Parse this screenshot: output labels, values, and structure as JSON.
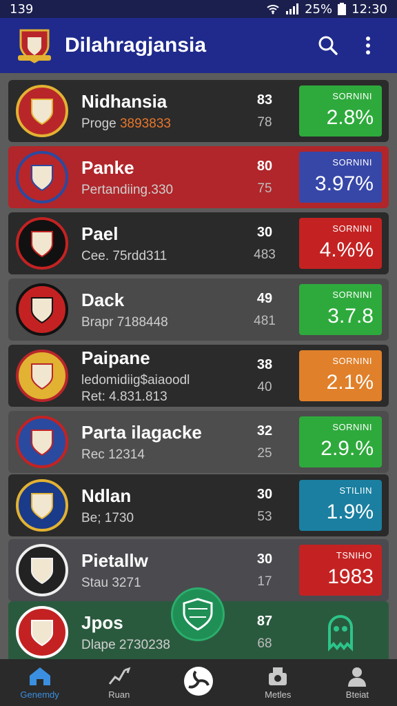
{
  "status": {
    "time_left": "139",
    "battery": "25%",
    "clock": "12:30"
  },
  "appbar": {
    "title": "Dilahragjansia",
    "search_icon": "search-icon",
    "menu_icon": "more-vert-icon"
  },
  "rows": [
    {
      "name": "Nidhansia",
      "sub": "Proge ",
      "sub_hl": "3893833",
      "n1": "83",
      "n2": "78",
      "score_label": "SORNINI",
      "score": "2.8%",
      "score_color": "#2eaa3c",
      "bg": "#2b2b2b"
    },
    {
      "name": "Panke",
      "sub": "Pertandiing.330",
      "sub_hl": "",
      "n1": "80",
      "n2": "75",
      "score_label": "SORNINI",
      "score": "3.97%",
      "score_color": "#3747a8",
      "bg": "#b0262a"
    },
    {
      "name": "Pael",
      "sub": "Cee. 75rdd311",
      "sub_hl": "",
      "n1": "30",
      "n2": "483",
      "score_label": "SORNINI",
      "score": "4.%%",
      "score_color": "#c42222",
      "bg": "#2a2a2a"
    },
    {
      "name": "Dack",
      "sub": "Brapr 7188448",
      "sub_hl": "",
      "n1": "49",
      "n2": "481",
      "score_label": "SORNINI",
      "score": "3.7.8",
      "score_color": "#2eaa3c",
      "bg": "#4a4a4a"
    },
    {
      "name": "Paipane",
      "sub": "ledomidiig$aiaoodl",
      "sub_hl": "",
      "sub2": "Ret: 4.831.813",
      "n1": "38",
      "n2": "40",
      "score_label": "SORNINI",
      "score": "2.1%",
      "score_color": "#e0802a",
      "bg": "#2b2b2b"
    },
    {
      "name": "Parta ilagacke",
      "sub": "Rec 12314",
      "sub_hl": "",
      "n1": "32",
      "n2": "25",
      "score_label": "SORNINI",
      "score": "2.9.%",
      "score_color": "#2eaa3c",
      "bg": "#4d4d4d"
    },
    {
      "name": "Ndlan",
      "sub": "Be; 1730",
      "sub_hl": "",
      "n1": "30",
      "n2": "53",
      "score_label": "STILIIN",
      "score": "1.9%",
      "score_color": "#1a7fa0",
      "bg": "#2a2a2a"
    },
    {
      "name": "Pietallw",
      "sub": "Stau 3271",
      "sub_hl": "",
      "n1": "30",
      "n2": "17",
      "score_label": "TSNIHO",
      "score": "1983",
      "score_color": "#c42222",
      "bg": "#4a4a4f"
    },
    {
      "name": "Jpos",
      "sub": "Dlape 2730238",
      "sub_hl": "",
      "n1": "87",
      "n2": "68",
      "score_label": "",
      "score": "",
      "score_color": "#2a5a3e",
      "bg": "#2a5a3e"
    }
  ],
  "nav": [
    {
      "label": "Genemdy",
      "icon": "home-icon",
      "active": true
    },
    {
      "label": "Ruan",
      "icon": "run-icon",
      "active": false
    },
    {
      "label": "",
      "icon": "ball-icon",
      "active": false
    },
    {
      "label": "Metles",
      "icon": "medals-icon",
      "active": false
    },
    {
      "label": "Bteiat",
      "icon": "profile-icon",
      "active": false
    }
  ],
  "colors": {
    "appbar": "#1f2a8c",
    "status": "#1a1f4e",
    "fab": "#1f8f56",
    "nav_active": "#3b8fe0"
  }
}
